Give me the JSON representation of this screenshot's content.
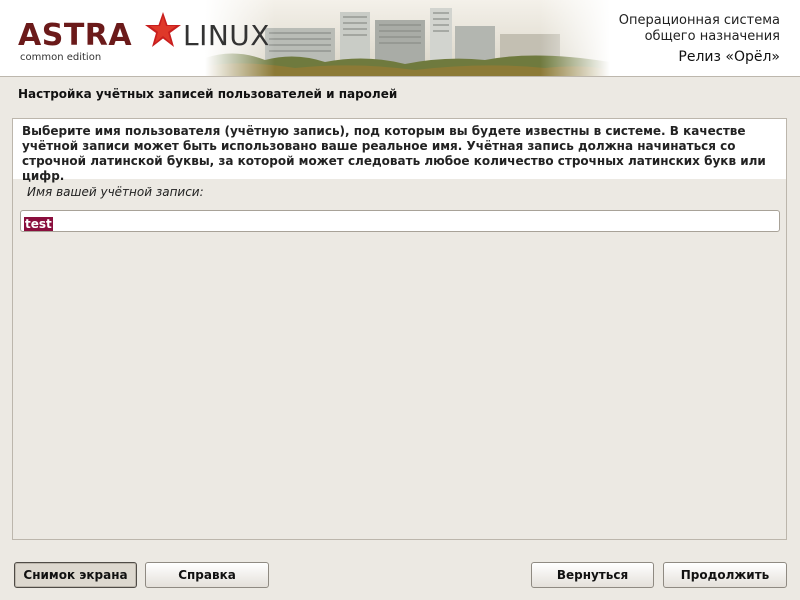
{
  "banner": {
    "logo_astra": "ASTRA",
    "logo_linux": "LINUX",
    "logo_edition": "common edition",
    "os_line1": "Операционная система",
    "os_line2": "общего назначения",
    "release": "Релиз «Орёл»"
  },
  "page": {
    "title": "Настройка учётных записей пользователей и паролей"
  },
  "form": {
    "description": "Выберите имя пользователя (учётную запись), под которым вы будете известны в системе. В качестве учётной записи может быть использовано ваше реальное имя. Учётная запись должна начинаться со строчной латинской буквы, за которой может следовать любое количество строчных латинских букв или цифр.",
    "username_label": "Имя вашей учётной записи:",
    "username_value": "test"
  },
  "buttons": {
    "screenshot": "Снимок экрана",
    "help": "Справка",
    "back": "Вернуться",
    "continue": "Продолжить"
  },
  "colors": {
    "brand_dark_red": "#6b1a1a",
    "star_red": "#c81e1e",
    "selection": "#8a0e3d",
    "background": "#ece9e3"
  }
}
